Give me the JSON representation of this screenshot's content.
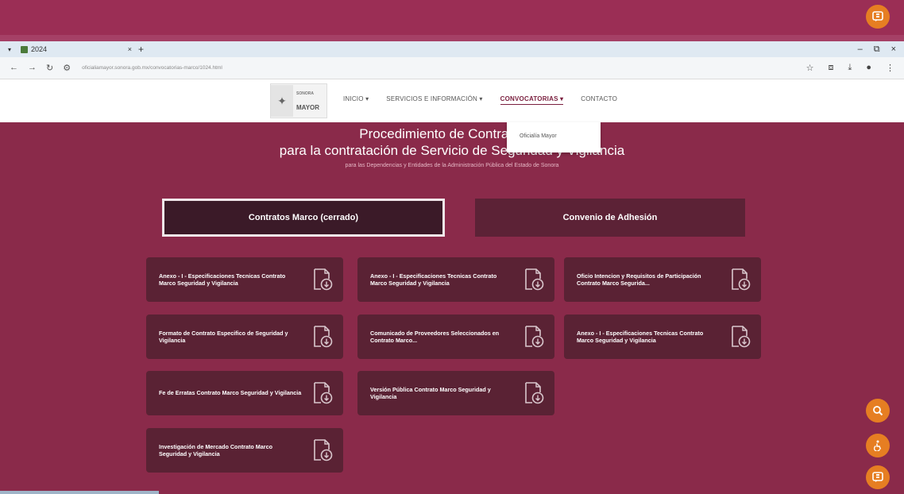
{
  "browser": {
    "tab_title": "2024",
    "url": "oficialiamayor.sonora.gob.mx/convocatorias-marco/1024.html",
    "icons": [
      "chevron-down-icon",
      "close-icon",
      "plus-icon",
      "minimize-icon",
      "restore-icon",
      "back-icon",
      "forward-icon",
      "reload-icon",
      "site-settings-icon",
      "star-icon",
      "extensions-icon",
      "download-icon",
      "profile-icon",
      "more-icon"
    ]
  },
  "site": {
    "logo": {
      "small": "SONORA",
      "big": "MAYOR"
    },
    "menu": [
      {
        "label": "INICIO",
        "has_caret": true
      },
      {
        "label": "SERVICIOS E INFORMACIÓN",
        "has_caret": true
      },
      {
        "label": "CONVOCATORIAS",
        "has_caret": true,
        "active": true
      },
      {
        "label": "CONTACTO",
        "has_caret": false
      }
    ],
    "dropdown": {
      "item": "Oficialía Mayor"
    }
  },
  "hero": {
    "title_line1": "Procedimiento de Contratación",
    "title_line2": "para la contratación de Servicio de Seguridad y Vigilancia",
    "subtitle": "para las Dependencias y Entidades de la Administración Pública del Estado de Sonora"
  },
  "buttons": {
    "contratos": "Contratos Marco (cerrado)",
    "convenio": "Convenio de Adhesión"
  },
  "cards": [
    "Anexo - I - Especificaciones Tecnicas Contrato Marco Seguridad y Vigilancia",
    "Anexo - I - Especificaciones Tecnicas Contrato Marco Seguridad y Vigilancia",
    "Oficio Intencion y Requisitos de Participación Contrato Marco Segurida...",
    "Formato de Contrato Especifico de Seguridad y Vigilancia",
    "Comunicado de Proveedores Seleccionados en Contrato Marco...",
    "Anexo - I - Especificaciones Tecnicas Contrato Marco Seguridad y Vigilancia",
    "Fe de Erratas Contrato Marco Seguridad y Vigilancia",
    "Versión Pública Contrato Marco Seguridad y Vigilancia",
    "Investigación de Mercado Contrato Marco Seguridad y Vigilancia"
  ],
  "colors": {
    "background": "#8a2a4a",
    "card": "#5a2234",
    "accent": "#e67e22"
  }
}
